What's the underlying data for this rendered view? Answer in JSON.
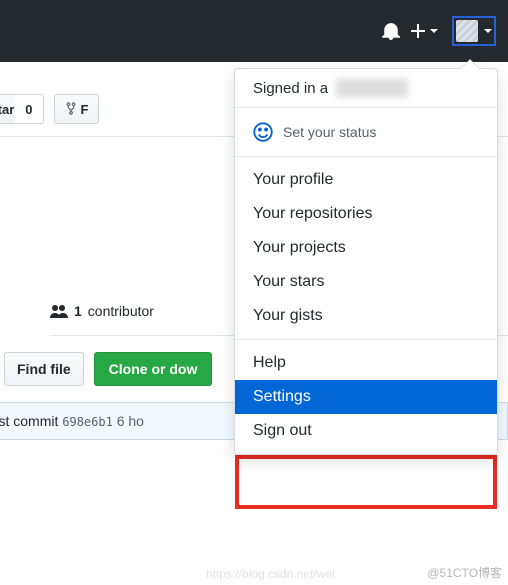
{
  "header": {
    "bell_icon": "notifications-icon",
    "plus_icon": "add-icon",
    "avatar_icon": "user-avatar"
  },
  "repo": {
    "star_label": "Star",
    "star_count": "0",
    "fork_label_partial": "F"
  },
  "contributor": {
    "count": "1",
    "label": "contributor"
  },
  "actions": {
    "find_file": "Find file",
    "clone": "Clone or dow"
  },
  "commit": {
    "prefix": "atest commit",
    "sha": "698e6b1",
    "time": "6 ho"
  },
  "dropdown": {
    "signed_in_prefix": "Signed in a",
    "status": "Set your status",
    "items": [
      "Your profile",
      "Your repositories",
      "Your projects",
      "Your stars",
      "Your gists"
    ],
    "help": "Help",
    "settings": "Settings",
    "signout": "Sign out"
  },
  "watermark": "@51CTO博客",
  "watermark2": "https://blog.csdn.net/wei"
}
